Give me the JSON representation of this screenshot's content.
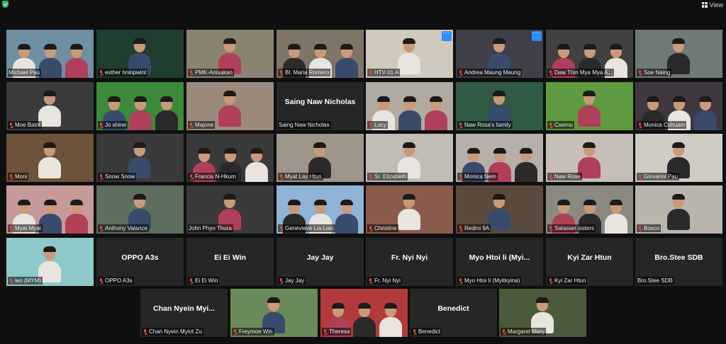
{
  "view": {
    "label": "View"
  },
  "colors": {
    "background": "#0f0f0f",
    "tile": "#262626",
    "mic_muted": "#e5453d",
    "speaker_border": "#d8d82a",
    "menu_badge": "#2d8cff"
  },
  "participants": [
    {
      "name": "Michael Pau",
      "video": true,
      "muted": false,
      "bg": "#6f8fa2"
    },
    {
      "name": "esther hninpwint",
      "video": true,
      "muted": true,
      "bg": "#1f3e2d"
    },
    {
      "name": "PMK-Anisakan",
      "video": true,
      "muted": true,
      "bg": "#8b8372"
    },
    {
      "name": "Bl. Maria Romero",
      "video": true,
      "muted": true,
      "bg": "#7e7566"
    },
    {
      "name": "HTV 01 A",
      "video": true,
      "muted": true,
      "bg": "#cfc9be",
      "menu": true
    },
    {
      "name": "Andrea Maung Maung",
      "video": true,
      "muted": true,
      "bg": "#3e3f48",
      "menu": true
    },
    {
      "name": "Daw Thin Mya Mya A...",
      "video": true,
      "muted": true,
      "bg": "#414141"
    },
    {
      "name": "Soe Naing",
      "video": true,
      "muted": true,
      "bg": "#6f7a74"
    },
    {
      "name": "Moe Baint",
      "video": true,
      "muted": true,
      "bg": "#3b3b3b"
    },
    {
      "name": "Jo shine",
      "video": true,
      "muted": true,
      "bg": "#3c8a3a",
      "speaking": true
    },
    {
      "name": "Majone",
      "video": true,
      "muted": true,
      "bg": "#9b8a7c"
    },
    {
      "name": "Saing Naw Nicholas",
      "video": false,
      "muted": false
    },
    {
      "name": "Lucy",
      "video": true,
      "muted": true,
      "bg": "#b1aaa0"
    },
    {
      "name": "Naw Rosa's family",
      "video": true,
      "muted": true,
      "bg": "#2f5a44"
    },
    {
      "name": "Csernu",
      "video": true,
      "muted": true,
      "bg": "#5e9a3f"
    },
    {
      "name": "Monica Cohuam",
      "video": true,
      "muted": true,
      "bg": "#3f3840"
    },
    {
      "name": "Moni",
      "video": true,
      "muted": true,
      "bg": "#6e5239"
    },
    {
      "name": "Snow Snow",
      "video": true,
      "muted": true,
      "bg": "#3a3a3a"
    },
    {
      "name": "Francis N-Hkum",
      "video": true,
      "muted": true,
      "bg": "#3a3a3a"
    },
    {
      "name": "Myat Lay Htun",
      "video": true,
      "muted": true,
      "bg": "#9e968b"
    },
    {
      "name": "Sr. Elizabeth",
      "video": true,
      "muted": true,
      "bg": "#c1bdb4"
    },
    {
      "name": "Monica Nem",
      "video": true,
      "muted": true,
      "bg": "#b7b0aa"
    },
    {
      "name": "Naw Rose",
      "video": true,
      "muted": true,
      "bg": "#c5bfb7"
    },
    {
      "name": "Giovanni Pau",
      "video": true,
      "muted": true,
      "bg": "#d0ccc4"
    },
    {
      "name": "Myat Myat",
      "video": true,
      "muted": true,
      "bg": "#c79a9a"
    },
    {
      "name": "Anthony Valance",
      "video": true,
      "muted": true,
      "bg": "#5d6d5e"
    },
    {
      "name": "John Phyo Thura",
      "video": true,
      "muted": false,
      "bg": "#3a3a3a"
    },
    {
      "name": "Genevieve Lia Lian",
      "video": true,
      "muted": true,
      "bg": "#8fb4d6"
    },
    {
      "name": "Christine",
      "video": true,
      "muted": true,
      "bg": "#8a5a4a"
    },
    {
      "name": "Redmi 9A",
      "video": true,
      "muted": true,
      "bg": "#5a4a3e"
    },
    {
      "name": "Salasian sisters",
      "video": true,
      "muted": true,
      "bg": "#8a8a80"
    },
    {
      "name": "Bosco",
      "video": true,
      "muted": true,
      "bg": "#b9b4ac"
    },
    {
      "name": "leo (MYM)",
      "video": true,
      "muted": true,
      "bg": "#8ec9c9"
    },
    {
      "name": "OPPO A3s",
      "video": false,
      "muted": true
    },
    {
      "name": "Ei Ei Win",
      "video": false,
      "muted": true
    },
    {
      "name": "Jay Jay",
      "video": false,
      "muted": true
    },
    {
      "name": "Fr. Nyi Nyi",
      "video": false,
      "muted": true
    },
    {
      "name": "Myo Htoi li (Myitkyina)",
      "display_name": "Myo Htoi li (Myi...",
      "video": false,
      "muted": true
    },
    {
      "name": "Kyi Zar Htun",
      "video": false,
      "muted": true
    },
    {
      "name": "Bro.Stee SDB",
      "video": false,
      "muted": false
    },
    {
      "name": "Chan Nyein Myint Zu",
      "display_name": "Chan Nyein Myi...",
      "video": false,
      "muted": true
    },
    {
      "name": "Freymoe Win",
      "video": true,
      "muted": true,
      "bg": "#6a8a5a"
    },
    {
      "name": "Theresa",
      "video": true,
      "muted": true,
      "bg": "#b33a3a"
    },
    {
      "name": "Benedict",
      "video": false,
      "muted": true
    },
    {
      "name": "Margaret Mary",
      "video": true,
      "muted": true,
      "bg": "#4a5a3a"
    }
  ]
}
